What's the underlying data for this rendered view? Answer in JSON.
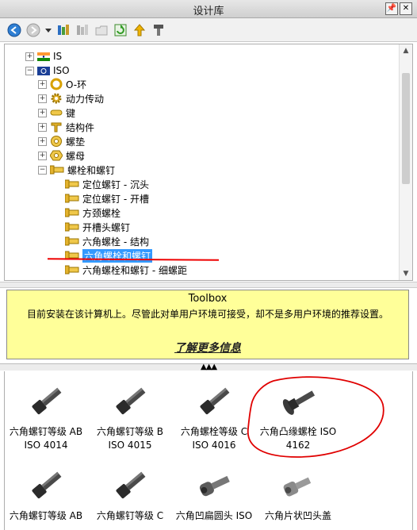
{
  "window": {
    "title": "设计库"
  },
  "tree": {
    "nodes": [
      {
        "label": "IS",
        "expander": "+"
      },
      {
        "label": "ISO",
        "expander": "−"
      },
      {
        "label": "O-环",
        "expander": "+"
      },
      {
        "label": "动力传动",
        "expander": "+"
      },
      {
        "label": "键",
        "expander": "+"
      },
      {
        "label": "结构件",
        "expander": "+"
      },
      {
        "label": "螺垫",
        "expander": "+"
      },
      {
        "label": "螺母",
        "expander": "+"
      },
      {
        "label": "螺栓和螺钉",
        "expander": "−"
      },
      {
        "label": "定位螺钉 - 沉头"
      },
      {
        "label": "定位螺钉 - 开槽"
      },
      {
        "label": "方颈螺栓"
      },
      {
        "label": "开槽头螺钉"
      },
      {
        "label": "六角螺栓 - 结构"
      },
      {
        "label": "六角螺栓和螺钉",
        "selected": true
      },
      {
        "label": "六角螺栓和螺钉 - 细螺距"
      }
    ]
  },
  "info": {
    "title": "Toolbox",
    "message": "目前安装在该计算机上。尽管此对单用户环境可接受，却不是多用户环境的推荐设置。",
    "link": "了解更多信息"
  },
  "grid": {
    "items": [
      {
        "line1": "六角螺钉等级 AB",
        "line2": "ISO 4014"
      },
      {
        "line1": "六角螺钉等级 B",
        "line2": "ISO 4015"
      },
      {
        "line1": "六角螺栓等级 C",
        "line2": "ISO 4016"
      },
      {
        "line1": "六角凸缘螺栓 ISO",
        "line2": "4162"
      },
      {
        "line1": "六角螺钉等级 AB",
        "line2": ""
      },
      {
        "line1": "六角螺钉等级 C",
        "line2": ""
      },
      {
        "line1": "六角凹扁圆头 ISO",
        "line2": ""
      },
      {
        "line1": "六角片状凹头盖",
        "line2": ""
      }
    ]
  },
  "colors": {
    "selection": "#3399ff",
    "info_bg": "#ffff99",
    "annotation": "#e00000"
  }
}
